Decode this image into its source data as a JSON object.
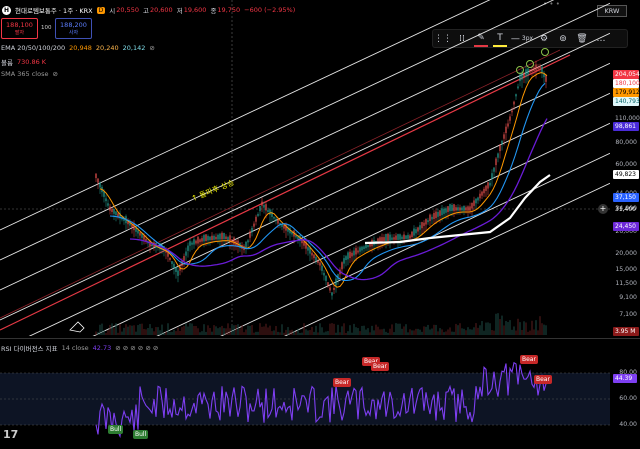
{
  "header": {
    "logo_glyph": "H",
    "symbol": "현대로템보통주 · 1주 · KRX",
    "badge_d": "D",
    "open_label": "시",
    "open": "20,550",
    "high_label": "고",
    "high": "20,600",
    "low_label": "저",
    "low": "19,600",
    "close_label": "종",
    "close": "19,750",
    "change": "−600 (−2.95%)",
    "currency": "KRW"
  },
  "order": {
    "sell_price": "188,100",
    "sell_label": "팔자",
    "qty": "100",
    "buy_price": "188,200",
    "buy_label": "사자"
  },
  "indicators": {
    "ema_label": "EMA 20/50/100/200",
    "ema20": "20,948",
    "ema50": "20,240",
    "ema100": "20,142",
    "volume_label": "볼륨",
    "volume": "730.86 K",
    "sma_label": "SMA 365 close",
    "rsi_label": "RSI 다이버전스 지표",
    "rsi_params": "14 close",
    "rsi_value": "42.73"
  },
  "toolbar": {
    "stroke_width": "3px"
  },
  "drawing": {
    "annotation": "↑ 돌파후 상승"
  },
  "price_axis": {
    "ticks": [
      "80,000",
      "60,000",
      "44,000",
      "34,000",
      "26,000",
      "20,000",
      "15,000",
      "11,500",
      "9,100",
      "7,100"
    ],
    "tags": [
      {
        "value": "204,054",
        "bg": "#f23645",
        "fg": "#ffffff"
      },
      {
        "value": "180,100",
        "bg": "#ffffff",
        "fg": "#f23645"
      },
      {
        "value": "179,912",
        "bg": "#ff9800",
        "fg": "#000000"
      },
      {
        "value": "140,793",
        "bg": "#e0f7fa",
        "fg": "#006064"
      },
      {
        "value": "110,000",
        "bg": "none",
        "fg": "#b2b5be"
      },
      {
        "value": "98,861",
        "bg": "#4a2bd8",
        "fg": "#ffffff"
      },
      {
        "value": "49,823",
        "bg": "#ffffff",
        "fg": "#000000"
      },
      {
        "value": "37,150",
        "bg": "#2962ff",
        "fg": "#ffffff"
      },
      {
        "value": "31,400",
        "bg": "none",
        "fg": "#ffffff"
      },
      {
        "value": "24,450",
        "bg": "#6d28d9",
        "fg": "#ffffff"
      },
      {
        "value": "3.95 M",
        "bg": "#8b1a1a",
        "fg": "#ffffff"
      }
    ]
  },
  "rsi_axis": {
    "ticks": [
      "80.00",
      "60.00",
      "40.00"
    ],
    "current": "44.39"
  },
  "signals": {
    "bull": "Bull",
    "bear": "Bear"
  },
  "watermark": "17",
  "colors": {
    "background": "#000000",
    "channel": "#ffffff",
    "trendline": "#e53945",
    "ema20": "#ff9800",
    "ema50": "#2196f3",
    "ema100": "#6a1bd6",
    "sma365": "#ffffff",
    "rsi": "#7e3ff2",
    "candle_up": "#ef5350",
    "candle_down": "#26a69a"
  }
}
